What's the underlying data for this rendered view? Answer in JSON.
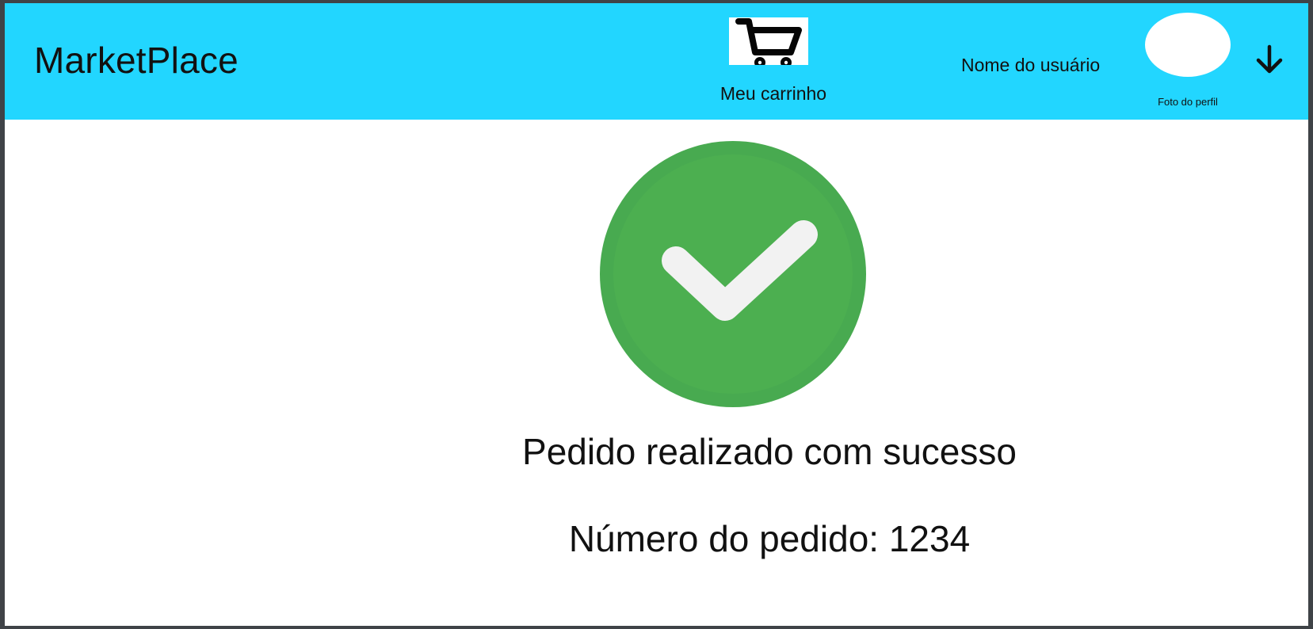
{
  "header": {
    "brand": "MarketPlace",
    "cart": {
      "label": "Meu carrinho",
      "icon": "shopping-cart-icon"
    },
    "user": {
      "name": "Nome do usuário",
      "avatar_caption": "Foto do perfil",
      "menu_icon": "arrow-down-icon"
    },
    "background_color": "#22d6ff"
  },
  "confirmation": {
    "icon": "check-circle-icon",
    "icon_color": "#4caf50",
    "check_color": "#f2f2f2",
    "title": "Pedido realizado com sucesso",
    "order_label": "Número do pedido:",
    "order_number": "1234"
  }
}
